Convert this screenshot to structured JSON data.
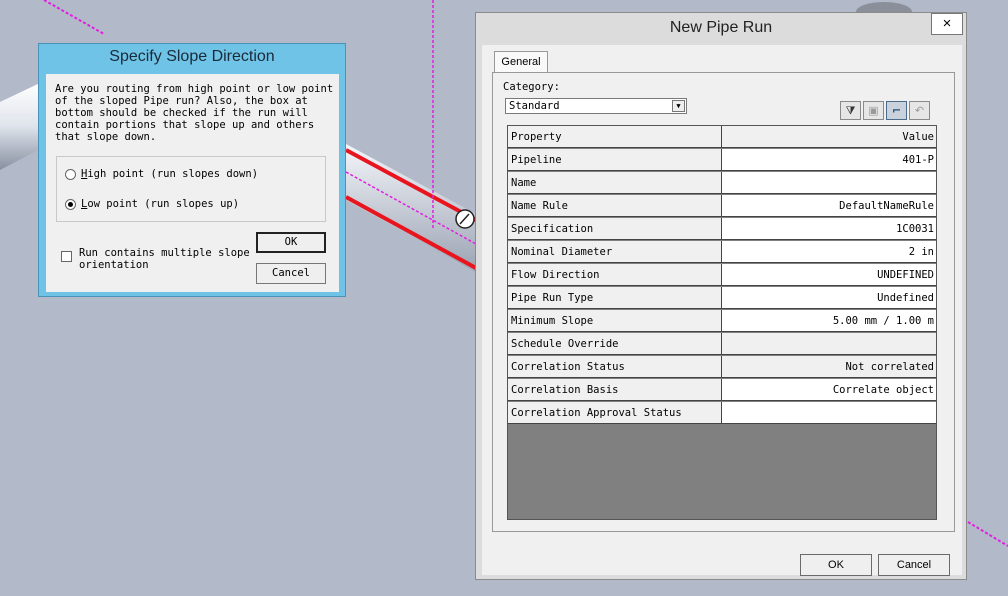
{
  "colors": {
    "background": "#b2b9c9",
    "slope_dialog_frame": "#6fc3e6",
    "pipe_highlight": "#e8141e",
    "construction_line": "#e020e0"
  },
  "slope_dialog": {
    "title": "Specify Slope Direction",
    "message": "Are you routing from high point or low point\nof the sloped Pipe run? Also, the box at\nbottom should be checked if the run will\ncontain portions that slope up and others\nthat slope down.",
    "options": [
      {
        "label": "High point (run slopes down)",
        "selected": false
      },
      {
        "label": "Low point (run slopes up)",
        "selected": true
      }
    ],
    "checkbox_label": "Run contains multiple slope\norientation",
    "checkbox_checked": false,
    "ok_label": "OK",
    "cancel_label": "Cancel"
  },
  "pipe_run_dialog": {
    "title": "New Pipe Run",
    "close_glyph": "×",
    "tab_label": "General",
    "category_label": "Category:",
    "category_value": "Standard",
    "toolbar_icons": [
      "filter-icon",
      "folder-icon",
      "pipe-icon",
      "undo-icon"
    ],
    "columns": {
      "property": "Property",
      "value": "Value"
    },
    "rows": [
      {
        "property": "Pipeline",
        "value": "401-P"
      },
      {
        "property": "Name",
        "value": ""
      },
      {
        "property": "Name Rule",
        "value": "DefaultNameRule"
      },
      {
        "property": "Specification",
        "value": "1C0031"
      },
      {
        "property": "Nominal Diameter",
        "value": "2 in"
      },
      {
        "property": "Flow Direction",
        "value": "UNDEFINED"
      },
      {
        "property": "Pipe Run Type",
        "value": "Undefined"
      },
      {
        "property": "Minimum Slope",
        "value": "5.00 mm / 1.00 m"
      },
      {
        "property": "Schedule Override",
        "value": ""
      },
      {
        "property": "Correlation Status",
        "value": "Not correlated"
      },
      {
        "property": "Correlation Basis",
        "value": "Correlate object"
      },
      {
        "property": "Correlation Approval Status",
        "value": ""
      }
    ],
    "ok_label": "OK",
    "cancel_label": "Cancel"
  }
}
